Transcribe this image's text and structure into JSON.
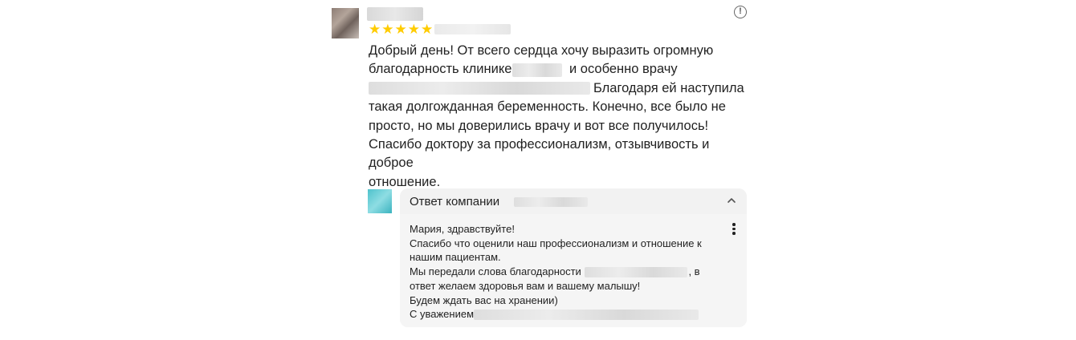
{
  "review": {
    "rating_stars": [
      "★",
      "★",
      "★",
      "★",
      "★"
    ],
    "rating_value": 5,
    "info_icon_glyph": "!",
    "text": {
      "p1": "Добрый день! От всего сердца хочу выразить огромную",
      "p2a": "благодарность клинике",
      "p2b": "и особенно врачу",
      "p3b": "Благодаря ей наступила",
      "p4": "такая долгожданная беременность. Конечно, все было не",
      "p5": "просто, но мы доверились врачу и вот все получилось!",
      "p6": "Спасибо доктору за профессионализм, отзывчивость и доброе",
      "p7": "отношение."
    }
  },
  "reply": {
    "title": "Ответ компании",
    "lines": {
      "l1": "Мария, здравствуйте!",
      "l2": "Спасибо что оценили наш профессионализм и отношение к",
      "l3": "нашим пациентам.",
      "l4a": "Мы передали слова благодарности",
      "l4b": ", в",
      "l5": "ответ желаем здоровья вам и вашему малышу!",
      "l6": "Будем ждать вас на хранении)",
      "l7": "С уважением"
    }
  },
  "colors": {
    "star": "#ffcc00",
    "reply_background": "#f2f2f2",
    "text": "#222222"
  },
  "icons": [
    "info-icon",
    "chevron-up-icon",
    "more-vertical-icon",
    "star-icon"
  ]
}
